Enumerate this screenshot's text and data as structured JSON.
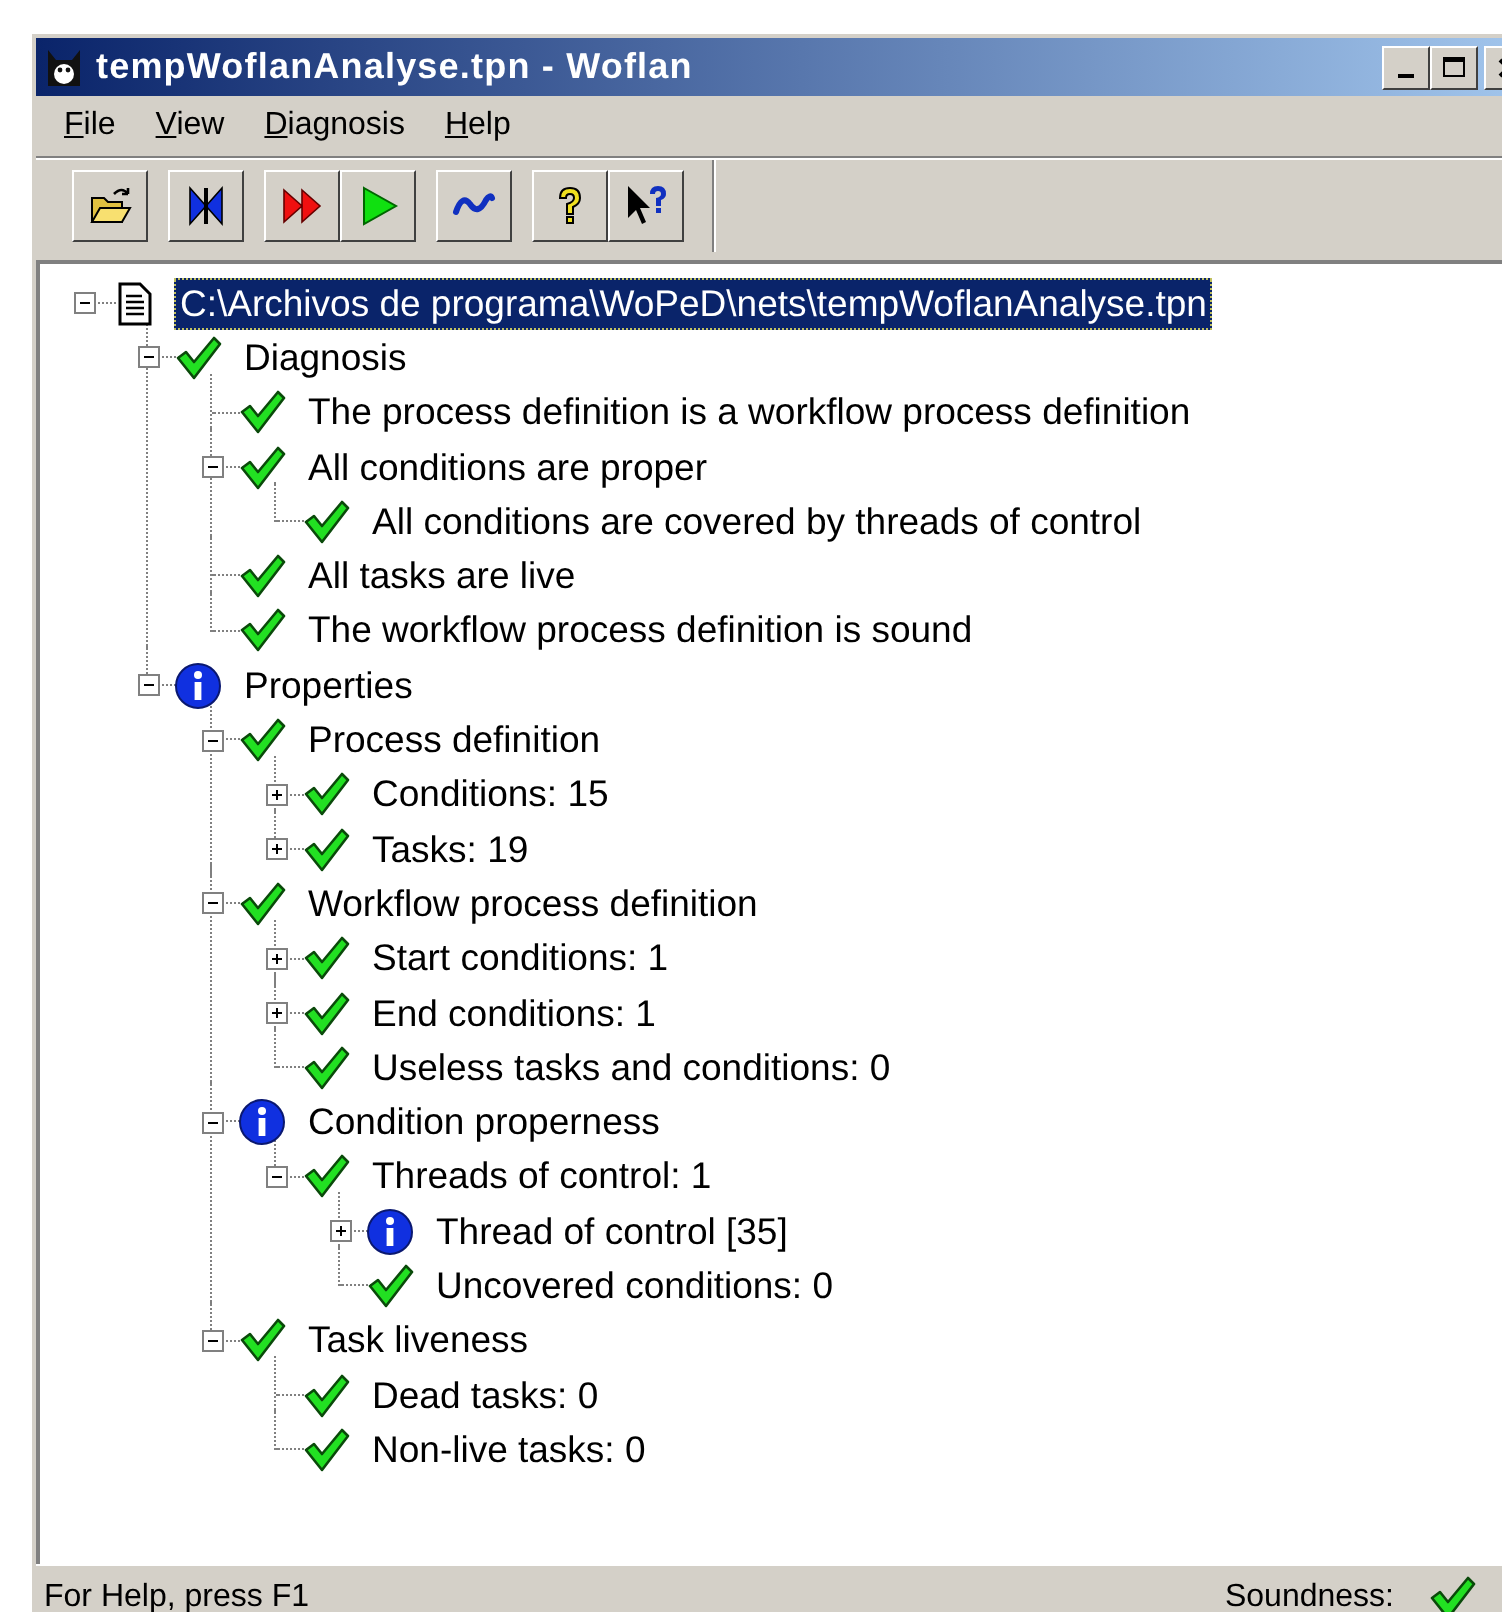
{
  "window": {
    "title": "tempWoflanAnalyse.tpn - Woflan"
  },
  "menu": [
    "File",
    "View",
    "Diagnosis",
    "Help"
  ],
  "toolbar": [
    [
      {
        "kind": "open"
      }
    ],
    [
      {
        "kind": "bowtie"
      }
    ],
    [
      {
        "kind": "fastforward"
      },
      {
        "kind": "play"
      }
    ],
    [
      {
        "kind": "wave"
      }
    ],
    [
      {
        "kind": "help"
      },
      {
        "kind": "contexthelp"
      }
    ]
  ],
  "tree": [
    {
      "kind": "document",
      "label": "C:\\Archivos de programa\\WoPeD\\nets\\tempWoflanAnalyse.tpn",
      "selected": true,
      "expanded": true,
      "children": [
        {
          "kind": "check",
          "label": "Diagnosis",
          "selected": false,
          "expanded": true,
          "children": [
            {
              "kind": "check",
              "label": "The process definition is a workflow process definition",
              "selected": false
            },
            {
              "kind": "check",
              "label": "All conditions are proper",
              "selected": false,
              "expanded": true,
              "children": [
                {
                  "kind": "check",
                  "label": "All conditions are covered by threads of control",
                  "selected": false
                }
              ]
            },
            {
              "kind": "check",
              "label": "All tasks are live",
              "selected": false
            },
            {
              "kind": "check",
              "label": "The workflow process definition is sound",
              "selected": false
            }
          ]
        },
        {
          "kind": "info",
          "label": "Properties",
          "selected": false,
          "expanded": true,
          "children": [
            {
              "kind": "check",
              "label": "Process definition",
              "selected": false,
              "expanded": true,
              "children": [
                {
                  "kind": "check",
                  "label": "Conditions: 15",
                  "selected": false,
                  "expanded": false
                },
                {
                  "kind": "check",
                  "label": "Tasks: 19",
                  "selected": false,
                  "expanded": false
                }
              ]
            },
            {
              "kind": "check",
              "label": "Workflow process definition",
              "selected": false,
              "expanded": true,
              "children": [
                {
                  "kind": "check",
                  "label": "Start conditions: 1",
                  "selected": false,
                  "expanded": false
                },
                {
                  "kind": "check",
                  "label": "End conditions: 1",
                  "selected": false,
                  "expanded": false
                },
                {
                  "kind": "check",
                  "label": "Useless tasks and conditions: 0",
                  "selected": false
                }
              ]
            },
            {
              "kind": "info",
              "label": "Condition properness",
              "selected": false,
              "expanded": true,
              "children": [
                {
                  "kind": "check",
                  "label": "Threads of control: 1",
                  "selected": false,
                  "expanded": true,
                  "children": [
                    {
                      "kind": "info",
                      "label": "Thread of control [35]",
                      "selected": false,
                      "expanded": false
                    },
                    {
                      "kind": "check",
                      "label": "Uncovered conditions: 0",
                      "selected": false
                    }
                  ]
                }
              ]
            },
            {
              "kind": "check",
              "label": "Task liveness",
              "selected": false,
              "expanded": true,
              "children": [
                {
                  "kind": "check",
                  "label": "Dead tasks: 0",
                  "selected": false
                },
                {
                  "kind": "check",
                  "label": "Non-live tasks: 0",
                  "selected": false
                }
              ]
            }
          ]
        }
      ]
    }
  ],
  "status_bar": {
    "text": "For Help, press F1",
    "soundness_label": "Soundness:",
    "sound": true
  }
}
